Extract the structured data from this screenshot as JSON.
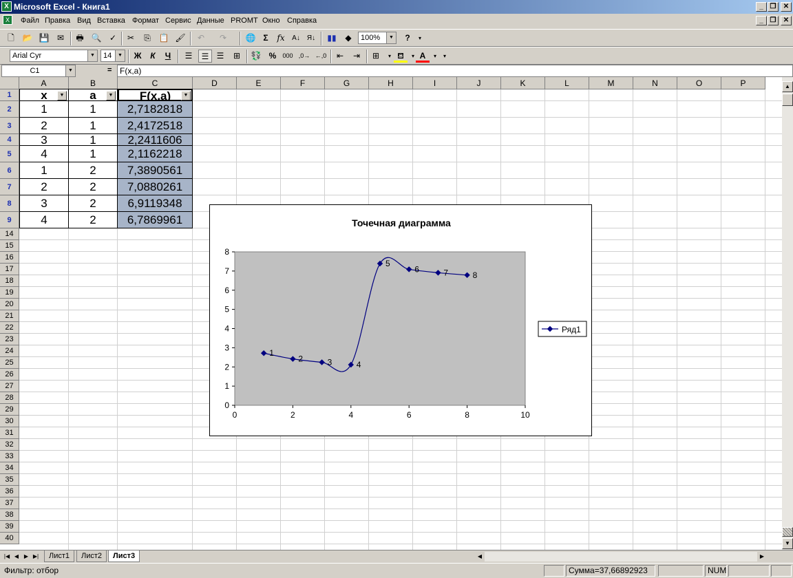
{
  "window": {
    "title": "Microsoft Excel - Книга1"
  },
  "menu": [
    "Файл",
    "Правка",
    "Вид",
    "Вставка",
    "Формат",
    "Сервис",
    "Данные",
    "PROMT",
    "Окно",
    "Справка"
  ],
  "toolbar": {
    "zoom": "100%"
  },
  "format_toolbar": {
    "font": "Arial Cyr",
    "size": "14",
    "bold": "Ж",
    "italic": "К",
    "underline": "Ч",
    "percent": "%",
    "thousands": "000"
  },
  "formula_bar": {
    "name_box": "C1",
    "eq": "=",
    "formula": "F(x,a)"
  },
  "columns": [
    "A",
    "B",
    "C",
    "D",
    "E",
    "F",
    "G",
    "H",
    "I",
    "J",
    "K",
    "L",
    "M",
    "N",
    "O",
    "P"
  ],
  "visible_rows": [
    "1",
    "2",
    "3",
    "4",
    "5",
    "6",
    "7",
    "8",
    "9",
    "14",
    "15",
    "16",
    "17",
    "18",
    "19",
    "20",
    "21",
    "22",
    "23",
    "24",
    "25",
    "26",
    "27",
    "28",
    "29",
    "30",
    "31",
    "32",
    "33",
    "34",
    "35",
    "36",
    "37",
    "38",
    "39",
    "40"
  ],
  "table": {
    "headers": [
      "x",
      "a",
      "F(x,a)"
    ],
    "rows": [
      [
        "1",
        "1",
        "2,7182818"
      ],
      [
        "2",
        "1",
        "2,4172518"
      ],
      [
        "3",
        "1",
        "2,2411606"
      ],
      [
        "4",
        "1",
        "2,1162218"
      ],
      [
        "1",
        "2",
        "7,3890561"
      ],
      [
        "2",
        "2",
        "7,0880261"
      ],
      [
        "3",
        "2",
        "6,9119348"
      ],
      [
        "4",
        "2",
        "6,7869961"
      ]
    ]
  },
  "chart_data": {
    "type": "scatter",
    "title": "Точечная диаграмма",
    "xlim": [
      0,
      10
    ],
    "ylim": [
      0,
      8
    ],
    "xticks": [
      "0",
      "2",
      "4",
      "6",
      "8",
      "10"
    ],
    "yticks": [
      "0",
      "1",
      "2",
      "3",
      "4",
      "5",
      "6",
      "7",
      "8"
    ],
    "legend_position": "right",
    "plot_area_color": "#c0c0c0",
    "series": [
      {
        "name": "Ряд1",
        "color": "#000080",
        "smoothed": true,
        "x": [
          1,
          2,
          3,
          4,
          5,
          6,
          7,
          8
        ],
        "y": [
          2.7182818,
          2.4172518,
          2.2411606,
          2.1162218,
          7.3890561,
          7.0880261,
          6.9119348,
          6.7869961
        ],
        "labels": [
          "1",
          "2",
          "3",
          "4",
          "5",
          "6",
          "7",
          "8"
        ]
      }
    ]
  },
  "sheets": [
    "Лист1",
    "Лист2",
    "Лист3"
  ],
  "active_sheet": "Лист3",
  "status": {
    "mode": "Фильтр: отбор",
    "sum": "Сумма=37,66892923",
    "num": "NUM"
  }
}
